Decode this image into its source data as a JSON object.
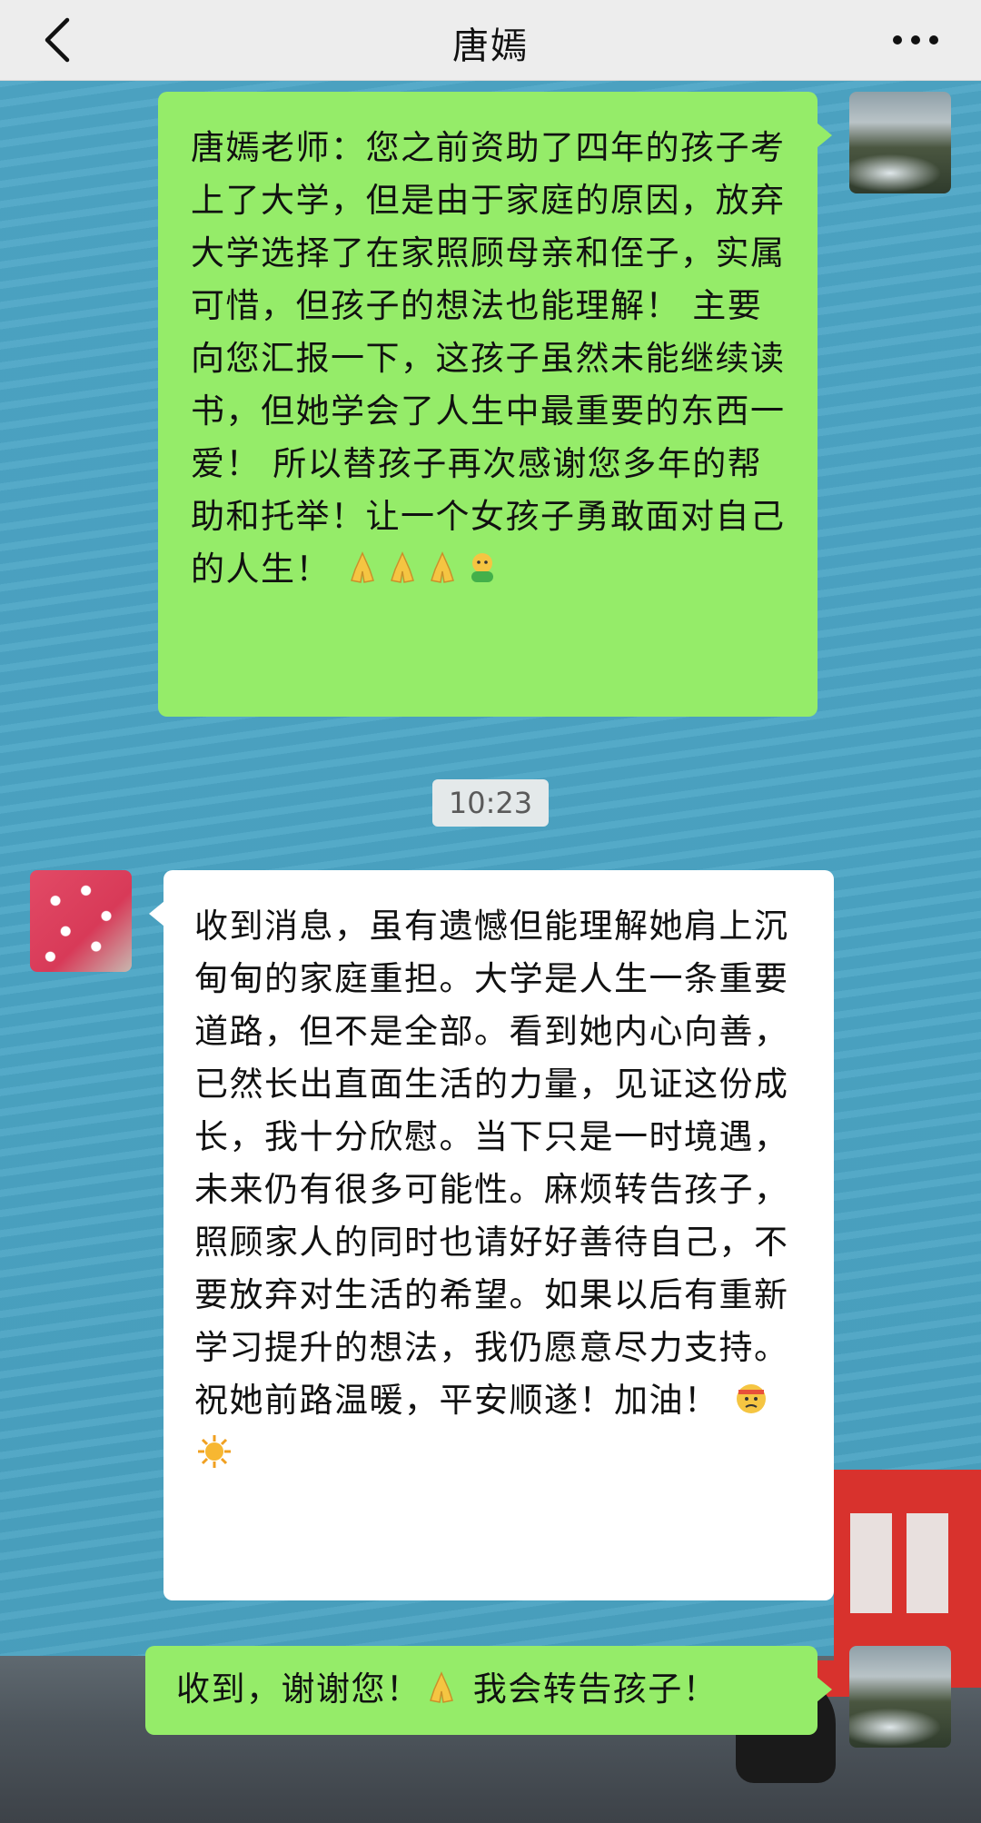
{
  "header": {
    "title": "唐嫣",
    "back_icon": "chevron-left-icon",
    "more_icon": "more-dots-icon"
  },
  "messages": [
    {
      "sender": "me",
      "text": "唐嫣老师：您之前资助了四年的孩子考上了大学，但是由于家庭的原因，放弃大学选择了在家照顾母亲和侄子，实属可惜，但孩子的想法也能理解！ 主要向您汇报一下，这孩子虽然未能继续读书，但她学会了人生中最重要的东西一爱！ 所以替孩子再次感谢您多年的帮助和托举！让一个女孩子勇敢面对自己的人生！",
      "emojis": [
        "folded-hands-icon",
        "folded-hands-icon",
        "folded-hands-icon",
        "hugging-face-icon"
      ]
    },
    {
      "sender": "them",
      "text": "收到消息，虽有遗憾但能理解她肩上沉甸甸的家庭重担。大学是人生一条重要道路，但不是全部。看到她内心向善，已然长出直面生活的力量，见证这份成长，我十分欣慰。当下只是一时境遇，未来仍有很多可能性。麻烦转告孩子，照顾家人的同时也请好好善待自己，不要放弃对生活的希望。如果以后有重新学习提升的想法，我仍愿意尽力支持。祝她前路温暖，平安顺遂！加油！",
      "emojis": [
        "determined-face-icon",
        "sun-icon"
      ]
    },
    {
      "sender": "me",
      "text_before": "收到，谢谢您！",
      "text_after": " 我会转告孩子！",
      "emojis": [
        "folded-hands-icon"
      ]
    }
  ],
  "timestamp": "10:23",
  "colors": {
    "nav_bg": "#ededed",
    "bubble_me": "#95ec69",
    "bubble_them": "#ffffff",
    "wallpaper": "#4aa3c4"
  }
}
